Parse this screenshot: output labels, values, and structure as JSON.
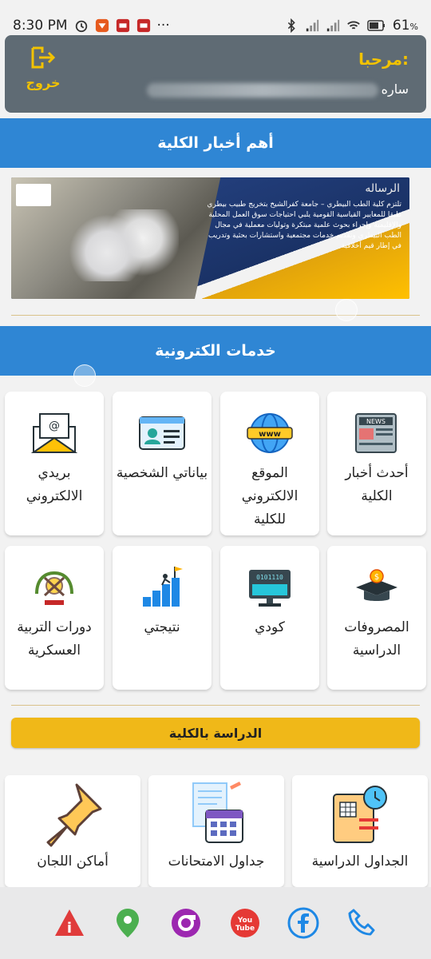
{
  "status_bar": {
    "time": "8:30 PM",
    "dots": "···",
    "battery": "61"
  },
  "header": {
    "welcome": "مرحبا:",
    "first_name": "ساره",
    "logout_label": "خروج"
  },
  "news_section": {
    "title": "أهم أخبار الكلية",
    "banner": {
      "heading": "الرساله",
      "text": "تلتزم كلية الطب البيطري – جامعة كفرالشيخ بتخريج طبيب بيطري طبقا للمعايير القياسية القومية يلبي احتياجات سوق العمل المحلية والإقليمية وإجراء بحوث علمية مبتكرة وتوليات معملية في مجال الطب البيطري وتقديم خدمات مجتمعية واستشارات بحثية وتدريب في إطار قيم أخلاقية"
    }
  },
  "e_services": {
    "title": "خدمات الكترونية",
    "tiles": [
      {
        "label": "أحدث أخبار الكلية",
        "icon": "newspaper-icon"
      },
      {
        "label": "الموقع الالكتروني للكلية",
        "icon": "globe-www-icon"
      },
      {
        "label": "بياناتي الشخصية",
        "icon": "id-card-icon"
      },
      {
        "label": "بريدي الالكتروني",
        "icon": "email-envelope-icon"
      },
      {
        "label": "المصروفات الدراسية",
        "icon": "graduation-cap-coin-icon"
      },
      {
        "label": "كودي",
        "icon": "binary-monitor-icon"
      },
      {
        "label": "نتيجتي",
        "icon": "climbing-flag-icon"
      },
      {
        "label": "دورات التربية العسكرية",
        "icon": "military-emblem-icon"
      }
    ]
  },
  "study_section": {
    "button_label": "الدراسة بالكلية",
    "tiles": [
      {
        "label": "الجداول الدراسية",
        "icon": "study-schedule-icon"
      },
      {
        "label": "جداول الامتحانات",
        "icon": "exam-calendar-icon"
      },
      {
        "label": "أماكن اللجان",
        "icon": "pushpin-icon"
      }
    ]
  },
  "bottom_bar": {
    "links": [
      {
        "name": "info-icon",
        "color": "#e03b3b"
      },
      {
        "name": "location-icon",
        "color": "#4caf50"
      },
      {
        "name": "music-app-icon",
        "color": "#9c27b0"
      },
      {
        "name": "youtube-icon",
        "color": "#e53935"
      },
      {
        "name": "facebook-icon",
        "color": "#1e88e5"
      },
      {
        "name": "phone-icon",
        "color": "#1e88e5"
      }
    ]
  },
  "colors": {
    "primary_blue": "#2f86d4",
    "accent_yellow": "#f0b818",
    "header_gray": "#5f6b74"
  }
}
